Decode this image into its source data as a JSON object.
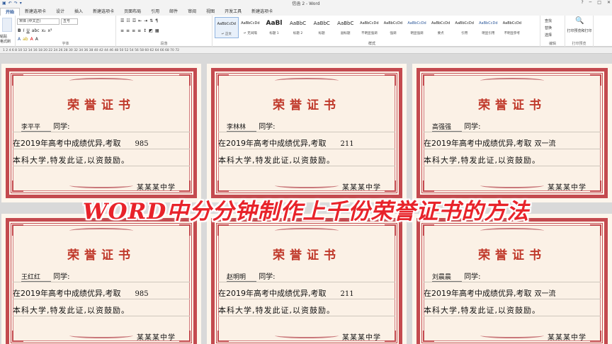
{
  "window": {
    "title": "信函 2 - Word",
    "qat_icons": [
      "save-icon",
      "undo-icon",
      "redo-icon",
      "customize-icon"
    ]
  },
  "tabs": [
    "开始",
    "新建选项卡",
    "设计",
    "插入",
    "新建选项卡",
    "页面布局",
    "引用",
    "邮件",
    "审阅",
    "视图",
    "开发工具",
    "新建选项卡"
  ],
  "ribbon": {
    "clipboard": {
      "paste": "粘贴",
      "cut": "剪切",
      "copy": "复制",
      "format_painter": "格式刷",
      "label": "剪贴板"
    },
    "font": {
      "name": "宋体 (中文正)",
      "size": "五号",
      "label": "字体"
    },
    "paragraph": {
      "label": "段落"
    },
    "styles": {
      "label": "样式",
      "items": [
        {
          "sample": "AaBbCcDd",
          "name": "↵ 正文"
        },
        {
          "sample": "AaBbCcDd",
          "name": "↵ 无间隔"
        },
        {
          "sample": "AaBl",
          "name": "标题 1"
        },
        {
          "sample": "AaBbC",
          "name": "标题 2"
        },
        {
          "sample": "AaBbC",
          "name": "标题"
        },
        {
          "sample": "AaBbC",
          "name": "副标题"
        },
        {
          "sample": "AaBbCcDd",
          "name": "不明显强调"
        },
        {
          "sample": "AaBbCcDd",
          "name": "强调"
        },
        {
          "sample": "AaBbCcDd",
          "name": "明显强调"
        },
        {
          "sample": "AaBbCcDd",
          "name": "要点"
        },
        {
          "sample": "AaBbCcDd",
          "name": "引用"
        },
        {
          "sample": "AaBbCcDd",
          "name": "明显引用"
        },
        {
          "sample": "AaBbCcDd",
          "name": "不明显参考"
        }
      ]
    },
    "editing": {
      "find": "查找",
      "replace": "替换",
      "select": "选择",
      "label": "编辑"
    },
    "print": {
      "button": "打印预览和打印",
      "label": "打印预览"
    }
  },
  "ruler": "1 2 4 6 8 10 12 14 16 18 20 22 24 26 28 30 32 34 36 38 40 42 44 46 48 50 52 54 56 58 60 62 64 66 68 70 72",
  "certificate": {
    "title": "荣誉证书",
    "greeting": "同学:",
    "line1_prefix": "在2019年高考中成绩优异,考取",
    "line2": "本科大学,特发此证,以资鼓励。",
    "signature": "某某某中学"
  },
  "certificates": [
    {
      "name": "李平平",
      "level": "985"
    },
    {
      "name": "李林林",
      "level": "211"
    },
    {
      "name": "高强强",
      "level": "双一流"
    },
    {
      "name": "王红红",
      "level": "985"
    },
    {
      "name": "赵明明",
      "level": "211"
    },
    {
      "name": "刘晨晨",
      "level": "双一流"
    }
  ],
  "banner": "WORD中分分钟制作上千份荣誉证书的方法"
}
